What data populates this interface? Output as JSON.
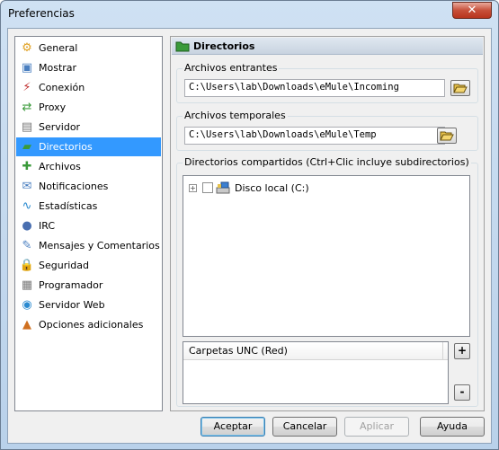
{
  "window": {
    "title": "Preferencias",
    "close_label": "✕"
  },
  "sidebar": {
    "items": [
      {
        "label": "General",
        "icon": "gear-icon",
        "color": "#e0a020",
        "glyph": "⚙"
      },
      {
        "label": "Mostrar",
        "icon": "display-icon",
        "color": "#4a7fc0",
        "glyph": "▣"
      },
      {
        "label": "Conexión",
        "icon": "connection-icon",
        "color": "#c03030",
        "glyph": "⚡"
      },
      {
        "label": "Proxy",
        "icon": "proxy-icon",
        "color": "#3a9a3a",
        "glyph": "⇄"
      },
      {
        "label": "Servidor",
        "icon": "server-icon",
        "color": "#7a7a7a",
        "glyph": "▤"
      },
      {
        "label": "Directorios",
        "icon": "folder-icon",
        "color": "#3a9a3a",
        "glyph": "▰",
        "selected": true
      },
      {
        "label": "Archivos",
        "icon": "files-icon",
        "color": "#3a9a3a",
        "glyph": "✚"
      },
      {
        "label": "Notificaciones",
        "icon": "notification-icon",
        "color": "#4a7fc0",
        "glyph": "✉"
      },
      {
        "label": "Estadísticas",
        "icon": "statistics-icon",
        "color": "#2a8ad0",
        "glyph": "∿"
      },
      {
        "label": "IRC",
        "icon": "irc-icon",
        "color": "#4a6fb0",
        "glyph": "●"
      },
      {
        "label": "Mensajes y Comentarios",
        "icon": "messages-icon",
        "color": "#4a7fc0",
        "glyph": "✎"
      },
      {
        "label": "Seguridad",
        "icon": "lock-icon",
        "color": "#d0a020",
        "glyph": "🔒"
      },
      {
        "label": "Programador",
        "icon": "calendar-icon",
        "color": "#7a7a7a",
        "glyph": "▦"
      },
      {
        "label": "Servidor Web",
        "icon": "web-icon",
        "color": "#2a8ad0",
        "glyph": "◉"
      },
      {
        "label": "Opciones adicionales",
        "icon": "options-icon",
        "color": "#d07020",
        "glyph": "▲"
      }
    ]
  },
  "panel": {
    "title": "Directorios",
    "incoming": {
      "label": "Archivos entrantes",
      "value": "C:\\Users\\lab\\Downloads\\eMule\\Incoming"
    },
    "temp": {
      "label": "Archivos temporales",
      "value": "C:\\Users\\lab\\Downloads\\eMule\\Temp"
    },
    "shared": {
      "label": "Directorios compartidos (Ctrl+Clic incluye subdirectorios)",
      "tree_items": [
        {
          "label": "Disco local (C:)",
          "expander": "+"
        }
      ]
    },
    "unc": {
      "header": "Carpetas UNC (Red)",
      "add_label": "+",
      "remove_label": "-"
    }
  },
  "buttons": {
    "accept": "Aceptar",
    "cancel": "Cancelar",
    "apply": "Aplicar",
    "help": "Ayuda"
  }
}
